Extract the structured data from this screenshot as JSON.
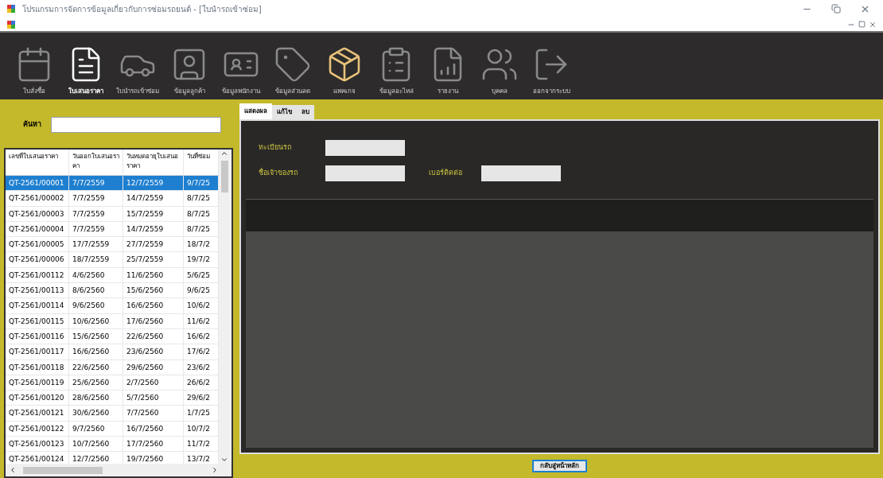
{
  "window": {
    "title": "โปรแกรมการจัดการข้อมูลเกี่ยวกับการซ่อมรถยนต์ - [ใบนำรถเข้าซ่อม]"
  },
  "toolbar": [
    {
      "label": "ใบสั่งซื้อ",
      "kind": "calendar",
      "selected": false
    },
    {
      "label": "ใบเสนอราคา",
      "kind": "quote",
      "selected": true
    },
    {
      "label": "ใบนำรถเข้าซ่อม",
      "kind": "car",
      "selected": false
    },
    {
      "label": "ข้อมูลลูกค้า",
      "kind": "customer",
      "selected": false
    },
    {
      "label": "ข้อมูลพนักงาน",
      "kind": "badge",
      "selected": false
    },
    {
      "label": "ข้อมูลส่วนลด",
      "kind": "tag",
      "selected": false
    },
    {
      "label": "แพคเกจ",
      "kind": "boxes",
      "selected": false
    },
    {
      "label": "ข้อมูลอะไหล่",
      "kind": "list",
      "selected": false
    },
    {
      "label": "รายงาน",
      "kind": "report",
      "selected": false
    },
    {
      "label": "บุคคล",
      "kind": "people",
      "selected": false
    },
    {
      "label": "ออกจากระบบ",
      "kind": "exit",
      "selected": false
    }
  ],
  "search": {
    "label": "ค้นหา"
  },
  "table": {
    "columns": [
      "เลขที่ใบเสนอราคา",
      "วันออกใบเสนอราคา",
      "วันหมดอายุใบเสนอราคา",
      "วันที่ซ่อม"
    ],
    "rows": [
      {
        "cells": [
          "QT-2561/00001",
          "7/7/2559",
          "12/7/2559",
          "9/7/25"
        ],
        "selected": true
      },
      {
        "cells": [
          "QT-2561/00002",
          "7/7/2559",
          "14/7/2559",
          "8/7/25"
        ],
        "selected": false
      },
      {
        "cells": [
          "QT-2561/00003",
          "7/7/2559",
          "15/7/2559",
          "8/7/25"
        ],
        "selected": false
      },
      {
        "cells": [
          "QT-2561/00004",
          "7/7/2559",
          "14/7/2559",
          "8/7/25"
        ],
        "selected": false
      },
      {
        "cells": [
          "QT-2561/00005",
          "17/7/2559",
          "27/7/2559",
          "18/7/2"
        ],
        "selected": false
      },
      {
        "cells": [
          "QT-2561/00006",
          "18/7/2559",
          "25/7/2559",
          "19/7/2"
        ],
        "selected": false
      },
      {
        "cells": [
          "QT-2561/00112",
          "4/6/2560",
          "11/6/2560",
          "5/6/25"
        ],
        "selected": false
      },
      {
        "cells": [
          "QT-2561/00113",
          "8/6/2560",
          "15/6/2560",
          "9/6/25"
        ],
        "selected": false
      },
      {
        "cells": [
          "QT-2561/00114",
          "9/6/2560",
          "16/6/2560",
          "10/6/2"
        ],
        "selected": false
      },
      {
        "cells": [
          "QT-2561/00115",
          "10/6/2560",
          "17/6/2560",
          "11/6/2"
        ],
        "selected": false
      },
      {
        "cells": [
          "QT-2561/00116",
          "15/6/2560",
          "22/6/2560",
          "16/6/2"
        ],
        "selected": false
      },
      {
        "cells": [
          "QT-2561/00117",
          "16/6/2560",
          "23/6/2560",
          "17/6/2"
        ],
        "selected": false
      },
      {
        "cells": [
          "QT-2561/00118",
          "22/6/2560",
          "29/6/2560",
          "23/6/2"
        ],
        "selected": false
      },
      {
        "cells": [
          "QT-2561/00119",
          "25/6/2560",
          "2/7/2560",
          "26/6/2"
        ],
        "selected": false
      },
      {
        "cells": [
          "QT-2561/00120",
          "28/6/2560",
          "5/7/2560",
          "29/6/2"
        ],
        "selected": false
      },
      {
        "cells": [
          "QT-2561/00121",
          "30/6/2560",
          "7/7/2560",
          "1/7/25"
        ],
        "selected": false
      },
      {
        "cells": [
          "QT-2561/00122",
          "9/7/2560",
          "16/7/2560",
          "10/7/2"
        ],
        "selected": false
      },
      {
        "cells": [
          "QT-2561/00123",
          "10/7/2560",
          "17/7/2560",
          "11/7/2"
        ],
        "selected": false
      },
      {
        "cells": [
          "QT-2561/00124",
          "12/7/2560",
          "19/7/2560",
          "13/7/2"
        ],
        "selected": false
      }
    ]
  },
  "tabs": [
    {
      "label": "แสดงผล",
      "selected": true
    },
    {
      "label": "แก้ไข",
      "selected": false
    },
    {
      "label": "ลบ",
      "selected": false
    }
  ],
  "form": {
    "fields": [
      {
        "label": "ทะเบียนรถ"
      },
      {
        "label": "ชื่อเจ้าของรถ"
      },
      {
        "label": "เบอร์ติดต่อ"
      }
    ]
  },
  "back_button": "กลับสู่หน้าหลัก"
}
